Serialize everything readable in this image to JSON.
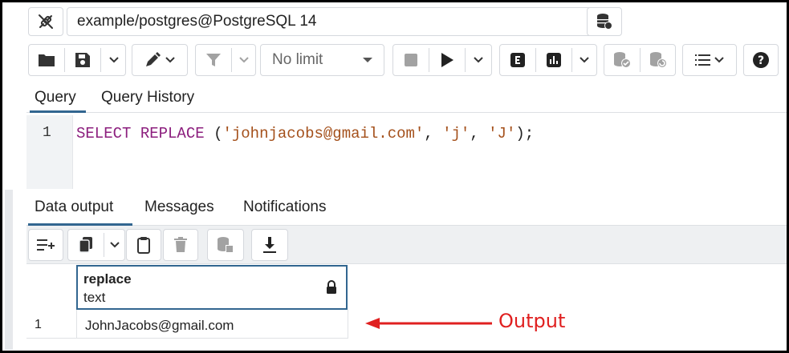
{
  "connection": {
    "label": "example/postgres@PostgreSQL 14"
  },
  "toolbar": {
    "limit_label": "No limit"
  },
  "editor_tabs": [
    {
      "label": "Query",
      "active": true
    },
    {
      "label": "Query History",
      "active": false
    }
  ],
  "editor": {
    "line_number": "1",
    "code": {
      "kw1": "SELECT",
      "kw2": "REPLACE",
      "open": "(",
      "arg1": "'johnjacobs@gmail.com'",
      "comma1": ",",
      "arg2": "'j'",
      "comma2": ",",
      "arg3": "'J'",
      "close": ");"
    }
  },
  "result_tabs": [
    {
      "label": "Data output",
      "active": true
    },
    {
      "label": "Messages",
      "active": false
    },
    {
      "label": "Notifications",
      "active": false
    }
  ],
  "grid": {
    "columns": [
      {
        "name": "replace",
        "type": "text"
      }
    ],
    "rows": [
      {
        "row_number": "1",
        "values": [
          "JohnJacobs@gmail.com"
        ]
      }
    ]
  },
  "annotation": {
    "label": "Output",
    "color": "#e02020"
  },
  "colors": {
    "accent": "#326690",
    "keyword": "#8c1f7e",
    "string": "#a4501b"
  }
}
